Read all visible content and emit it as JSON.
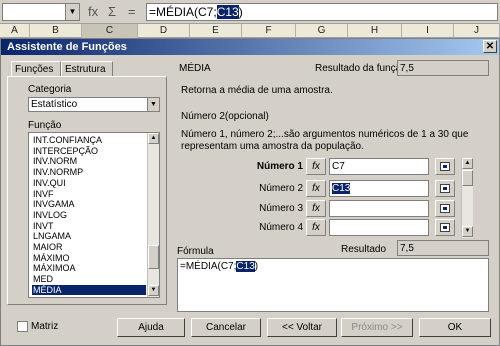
{
  "formula_bar": {
    "functions_icon": "fx",
    "sum_icon": "Σ",
    "equals_icon": "=",
    "formula_prefix": "=MÉDIA(C7;",
    "formula_selected": "C13",
    "formula_suffix": ")"
  },
  "columns": [
    "A",
    "B",
    "C",
    "D",
    "E",
    "F",
    "G",
    "H",
    "I",
    "J"
  ],
  "dialog": {
    "title": "Assistente de Funções",
    "close": "✕",
    "tabs": {
      "functions": "Funções",
      "structure": "Estrutura"
    },
    "category_label": "Categoria",
    "category_value": "Estatístico",
    "function_label": "Função",
    "functions": [
      "INT.CONFIANÇA",
      "INTERCEPÇÃO",
      "INV.NORM",
      "INV.NORMP",
      "INV.QUI",
      "INVF",
      "INVGAMA",
      "INVLOG",
      "INVT",
      "LNGAMA",
      "MAIOR",
      "MÁXIMO",
      "MÁXIMOA",
      "MED",
      "MÉDIA"
    ],
    "selected_function": "MÉDIA",
    "function_name": "MÉDIA",
    "function_result_label": "Resultado da função",
    "function_result_value": "7,5",
    "description": "Retorna a média de uma amostra.",
    "arg_title": "Número 2(opcional)",
    "arg_description": "Número 1, número 2;...são argumentos numéricos de 1 a 30 que representam uma amostra da população.",
    "args": [
      {
        "label": "Número 1",
        "value": "C7",
        "fx": "fx"
      },
      {
        "label": "Número 2",
        "value": "C13",
        "fx": "fx"
      },
      {
        "label": "Número 3",
        "value": "",
        "fx": "fx"
      },
      {
        "label": "Número 4",
        "value": "",
        "fx": "fx"
      }
    ],
    "formula_label": "Fórmula",
    "result_label": "Resultado",
    "result_value": "7,5",
    "formula_prefix": "=MÉDIA(C7;",
    "formula_selected": "C13",
    "formula_suffix": ")",
    "matrix_label": "Matriz",
    "buttons": {
      "help": "Ajuda",
      "cancel": "Cancelar",
      "back": "<< Voltar",
      "next": "Próximo >>",
      "ok": "OK"
    }
  }
}
